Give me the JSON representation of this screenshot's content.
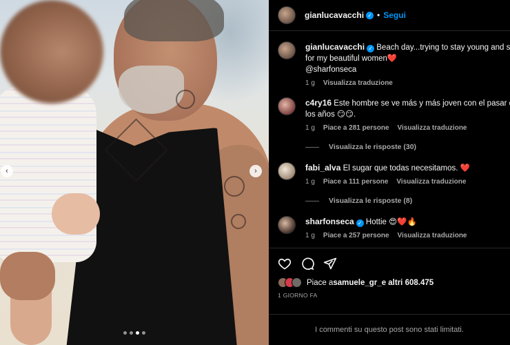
{
  "post": {
    "author": "gianlucavacchi",
    "follow_label": "Segui",
    "separator": "•"
  },
  "carousel": {
    "slide_count": 4,
    "active_slide": 3
  },
  "caption": {
    "username": "gianlucavacchi",
    "text": "Beach day...trying to stay young and st",
    "text_line2": "for my beautiful women❤️",
    "mention": "@sharfonseca",
    "time": "1 g",
    "translate": "Visualizza traduzione"
  },
  "comments": [
    {
      "username": "c4ry16",
      "text": "Este hombre se ve más y más joven con el pasar de",
      "text_line2": "los años 😏😏.",
      "time": "1 g",
      "likes": "Piace a 281 persone",
      "translate": "Visualizza traduzione",
      "replies": "Visualizza le risposte (30)"
    },
    {
      "username": "fabi_alva",
      "text": "El sugar que todas necesitamos. ❤️",
      "time": "1 g",
      "likes": "Piace a 111 persone",
      "translate": "Visualizza traduzione",
      "replies": "Visualizza le risposte (8)"
    },
    {
      "username": "sharfonseca",
      "text": "Hottie 😍❤️🔥",
      "time": "1 g",
      "likes": "Piace a 257 persone",
      "translate": "Visualizza traduzione"
    }
  ],
  "likes_summary": {
    "prefix": "Piace a ",
    "user": "samuele_gr_",
    "suffix": " e altri 608.475"
  },
  "date_label": "1 GIORNO FA",
  "limited_notice": "I commenti su questo post sono stati limitati.",
  "colors": {
    "background": "#000000",
    "link_blue": "#0095f6",
    "secondary_text": "#a8a8a8",
    "heart_red": "#ed4956"
  }
}
